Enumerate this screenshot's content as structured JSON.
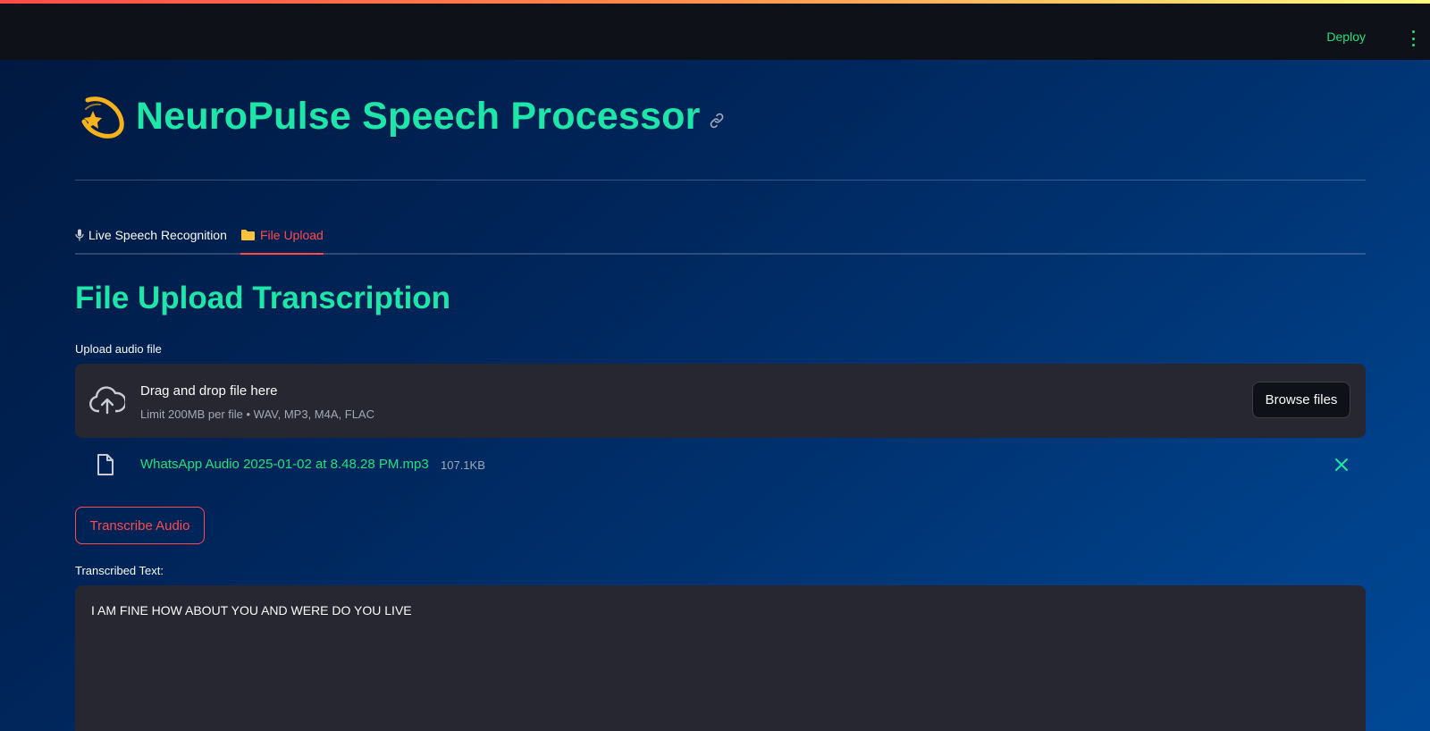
{
  "header": {
    "deploy_label": "Deploy"
  },
  "app": {
    "title": "NeuroPulse Speech Processor",
    "logo_icon": "comet-icon",
    "accent_color": "#1ee6a8",
    "active_color": "#ff4b4b"
  },
  "tabs": [
    {
      "label": "Live Speech Recognition",
      "icon": "microphone-icon",
      "active": false
    },
    {
      "label": "File Upload",
      "icon": "folder-icon",
      "active": true
    }
  ],
  "upload": {
    "section_title": "File Upload Transcription",
    "label": "Upload audio file",
    "drop_text": "Drag and drop file here",
    "limit_text": "Limit 200MB per file • WAV, MP3, M4A, FLAC",
    "browse_label": "Browse files",
    "file": {
      "name": "WhatsApp Audio 2025-01-02 at 8.48.28 PM.mp3",
      "size": "107.1KB"
    }
  },
  "transcribe": {
    "button_label": "Transcribe Audio",
    "result_label": "Transcribed Text:",
    "result_text": "I AM FINE HOW ABOUT YOU AND WERE DO YOU LIVE"
  }
}
